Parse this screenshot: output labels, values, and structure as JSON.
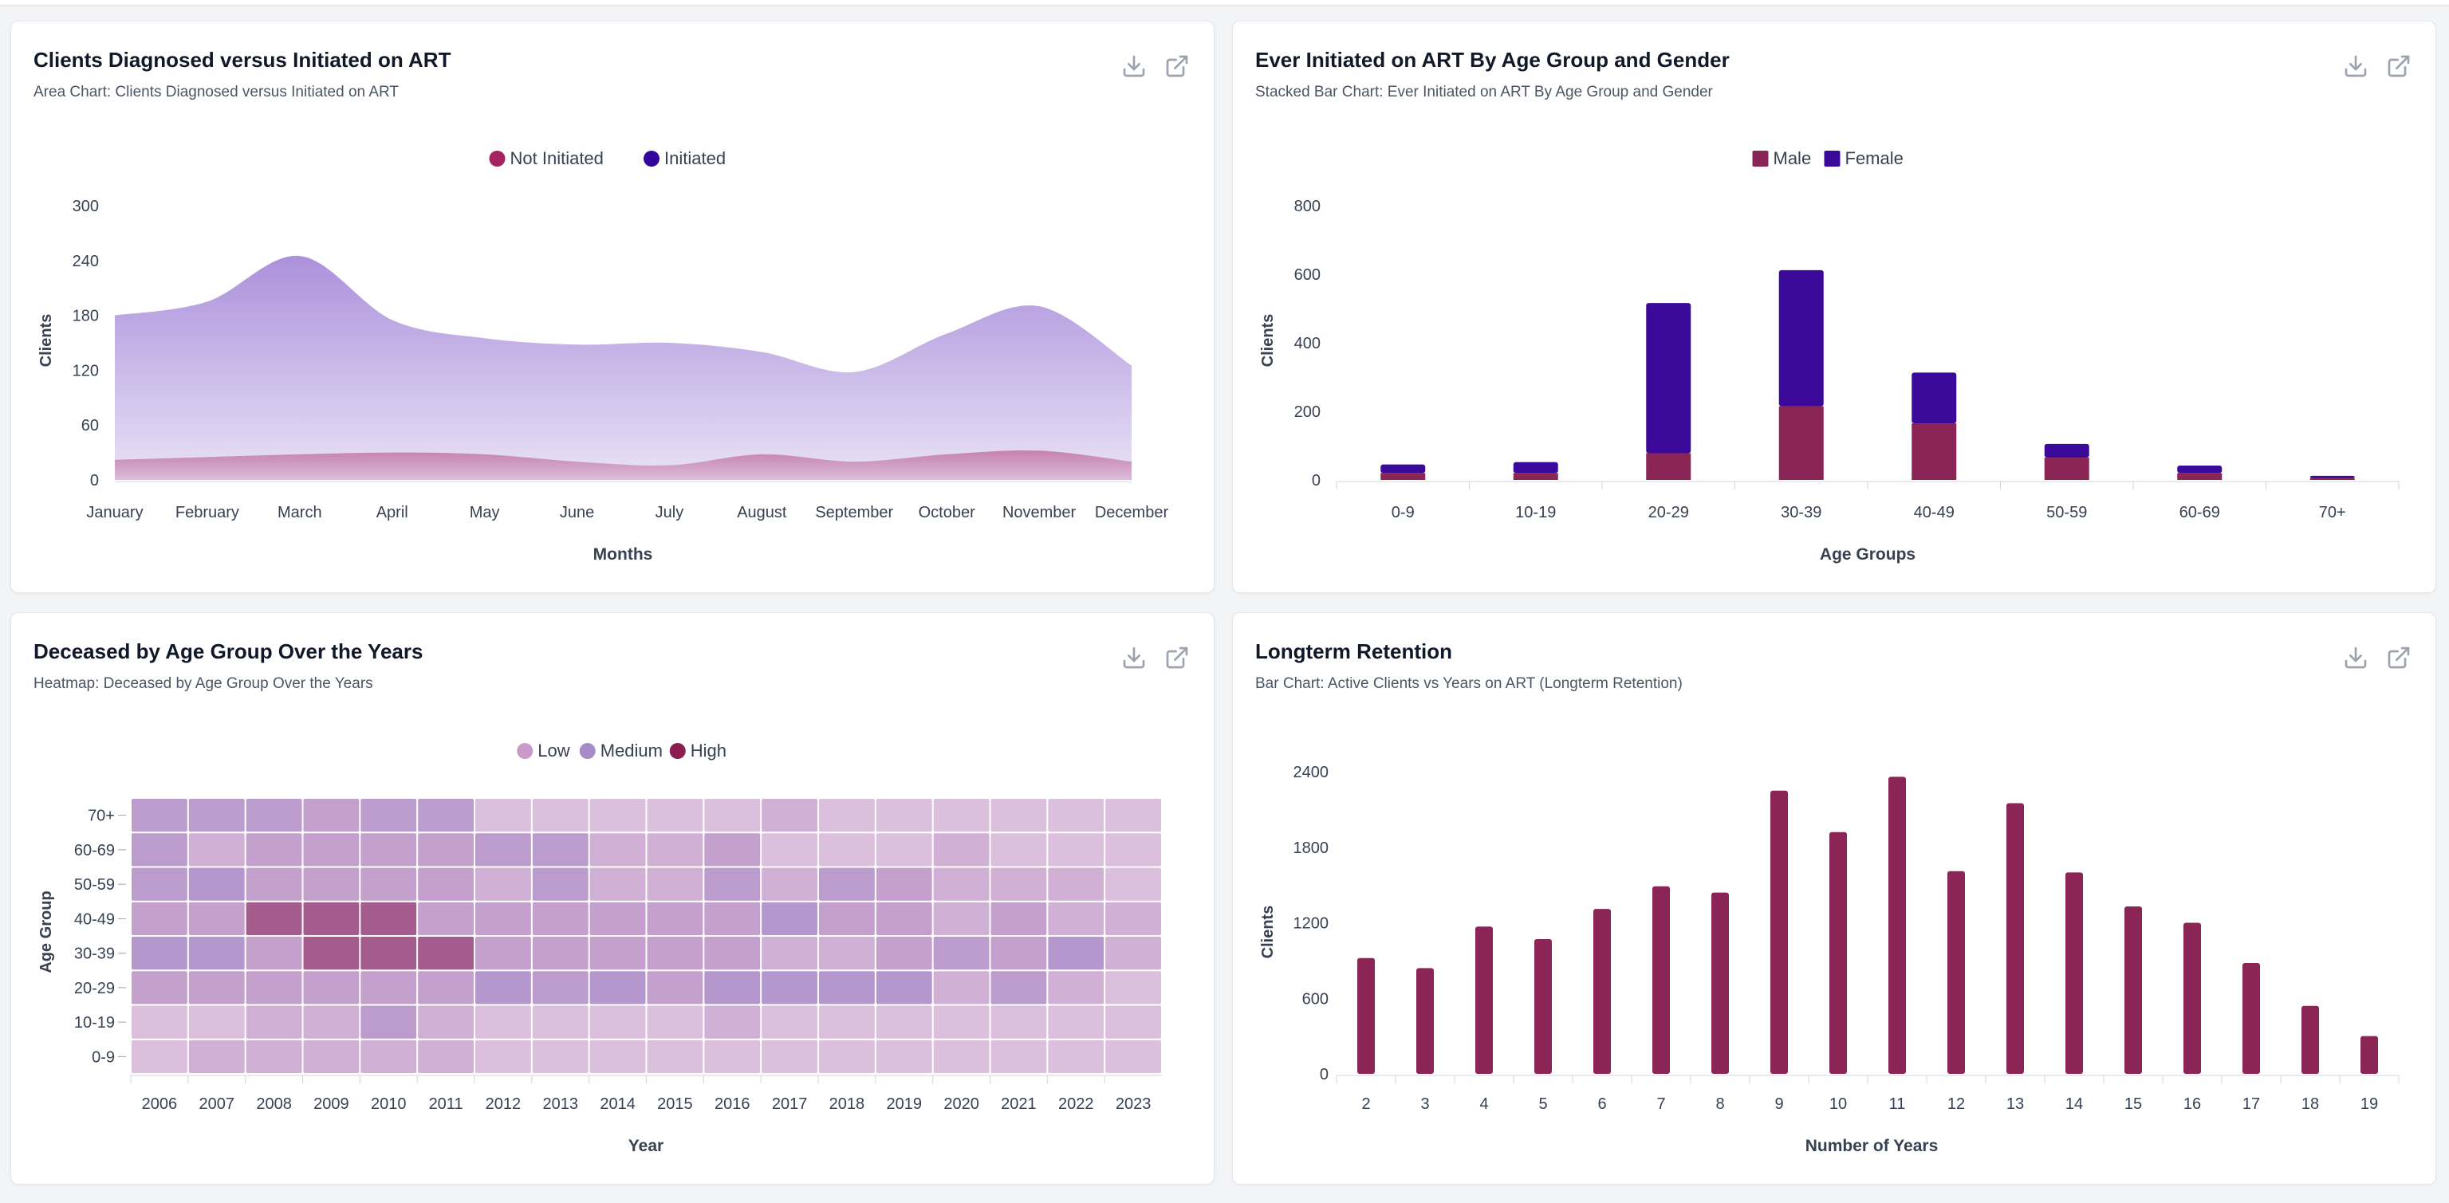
{
  "colors": {
    "maroon": "#8b2556",
    "indigo": "#3b0a9b",
    "area_purple": "#a78bda",
    "heat_low": "#d9b8d6",
    "heat_medium": "#b3a0d6",
    "heat_high": "#a8466f"
  },
  "icons": {
    "download": "download-icon",
    "external": "external-link-icon"
  },
  "chart_data": [
    {
      "type": "area",
      "title": "Clients Diagnosed versus Initiated on ART",
      "subtitle": "Area Chart: Clients Diagnosed versus Initiated on ART",
      "xlabel": "Months",
      "ylabel": "Clients",
      "ylim": [
        0,
        300
      ],
      "yticks": [
        "0",
        "60",
        "120",
        "180",
        "240",
        "300"
      ],
      "categories": [
        "January",
        "February",
        "March",
        "April",
        "May",
        "June",
        "July",
        "August",
        "September",
        "October",
        "November",
        "December"
      ],
      "series": [
        {
          "name": "Not Initiated",
          "color": "#a3245e",
          "values": [
            22,
            25,
            28,
            30,
            28,
            20,
            16,
            28,
            20,
            28,
            32,
            20
          ]
        },
        {
          "name": "Initiated",
          "color": "#33059a",
          "values": [
            180,
            195,
            245,
            175,
            155,
            148,
            150,
            140,
            118,
            160,
            190,
            125
          ]
        }
      ],
      "legend": "top-center",
      "grid": false
    },
    {
      "type": "bar",
      "title": "Ever Initiated on ART By Age Group and Gender",
      "subtitle": "Stacked Bar Chart: Ever Initiated on ART By Age Group and Gender",
      "xlabel": "Age Groups",
      "ylabel": "Clients",
      "ylim": [
        0,
        800
      ],
      "yticks": [
        "0",
        "200",
        "400",
        "600",
        "800"
      ],
      "categories": [
        "0-9",
        "10-19",
        "20-29",
        "30-39",
        "40-49",
        "50-59",
        "60-69",
        "70+"
      ],
      "stacked": true,
      "series": [
        {
          "name": "Male",
          "color": "#8b2556",
          "values": [
            20,
            20,
            78,
            215,
            165,
            65,
            20,
            5
          ]
        },
        {
          "name": "Female",
          "color": "#3b0a9b",
          "values": [
            25,
            32,
            438,
            397,
            148,
            40,
            22,
            7
          ]
        }
      ],
      "legend": "top-center",
      "grid": false
    },
    {
      "type": "heatmap",
      "title": "Deceased by Age Group Over the Years",
      "subtitle": "Heatmap: Deceased by Age Group Over the Years",
      "xlabel": "Year",
      "ylabel": "Age Group",
      "x": [
        "2006",
        "2007",
        "2008",
        "2009",
        "2010",
        "2011",
        "2012",
        "2013",
        "2014",
        "2015",
        "2016",
        "2017",
        "2018",
        "2019",
        "2020",
        "2021",
        "2022",
        "2023"
      ],
      "y": [
        "70+",
        "60-69",
        "50-59",
        "40-49",
        "30-39",
        "20-29",
        "10-19",
        "0-9"
      ],
      "levels": [
        {
          "name": "Low",
          "color": "#c99ac8"
        },
        {
          "name": "Medium",
          "color": "#a78bc9"
        },
        {
          "name": "High",
          "color": "#8a1f4f"
        }
      ],
      "values": [
        [
          5,
          5,
          5,
          4,
          5,
          5,
          2,
          2,
          2,
          2,
          2,
          3,
          2,
          2,
          2,
          2,
          2,
          2
        ],
        [
          5,
          3,
          4,
          4,
          4,
          4,
          5,
          5,
          3,
          3,
          4,
          2,
          2,
          2,
          3,
          2,
          2,
          2
        ],
        [
          5,
          6,
          4,
          4,
          4,
          4,
          3,
          5,
          3,
          3,
          5,
          3,
          5,
          4,
          3,
          3,
          3,
          2
        ],
        [
          4,
          4,
          9,
          9,
          9,
          4,
          4,
          4,
          4,
          4,
          4,
          6,
          4,
          4,
          3,
          4,
          3,
          3
        ],
        [
          6,
          6,
          4,
          9,
          9,
          9,
          4,
          4,
          4,
          4,
          4,
          3,
          3,
          4,
          5,
          4,
          6,
          3
        ],
        [
          4,
          4,
          4,
          4,
          4,
          4,
          6,
          5,
          6,
          4,
          6,
          6,
          6,
          6,
          3,
          5,
          3,
          2
        ],
        [
          2,
          2,
          3,
          3,
          5,
          3,
          2,
          2,
          2,
          2,
          3,
          2,
          2,
          2,
          2,
          2,
          2,
          2
        ],
        [
          2,
          3,
          3,
          3,
          3,
          3,
          2,
          2,
          2,
          2,
          2,
          2,
          2,
          2,
          2,
          2,
          2,
          2
        ]
      ],
      "legend": "top-center"
    },
    {
      "type": "bar",
      "title": "Longterm Retention",
      "subtitle": "Bar Chart: Active Clients vs Years on ART (Longterm Retention)",
      "xlabel": "Number of Years",
      "ylabel": "Clients",
      "ylim": [
        0,
        2400
      ],
      "yticks": [
        "0",
        "600",
        "1200",
        "1800",
        "2400"
      ],
      "categories": [
        "2",
        "3",
        "4",
        "5",
        "6",
        "7",
        "8",
        "9",
        "10",
        "11",
        "12",
        "13",
        "14",
        "15",
        "16",
        "17",
        "18",
        "19"
      ],
      "series": [
        {
          "name": "Clients",
          "color": "#8b2556",
          "values": [
            920,
            840,
            1170,
            1070,
            1310,
            1490,
            1440,
            2250,
            1920,
            2360,
            1610,
            2150,
            1600,
            1330,
            1200,
            880,
            540,
            300
          ]
        }
      ],
      "legend": "none",
      "grid": false
    }
  ]
}
